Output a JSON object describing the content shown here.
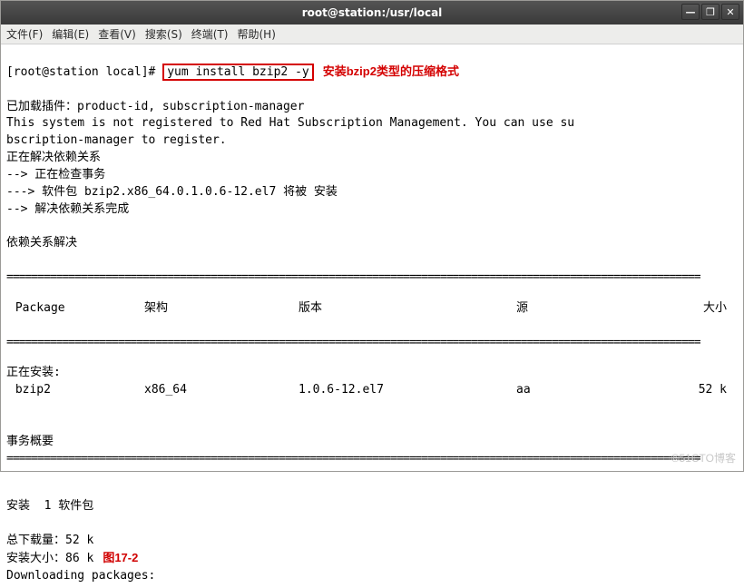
{
  "window": {
    "title": "root@station:/usr/local",
    "min": "—",
    "max": "❐",
    "close": "✕"
  },
  "menubar": {
    "file": "文件(F)",
    "edit": "编辑(E)",
    "view": "查看(V)",
    "search": "搜索(S)",
    "terminal": "终端(T)",
    "help": "帮助(H)"
  },
  "prompt": "[root@station local]# ",
  "command": "yum install bzip2 -y",
  "annotation1": "安装bzip2类型的压缩格式",
  "line2": "已加载插件：product-id, subscription-manager",
  "line3": "This system is not registered to Red Hat Subscription Management. You can use su",
  "line4": "bscription-manager to register.",
  "line5": "正在解决依赖关系",
  "line6": "--> 正在检查事务",
  "line7": "---> 软件包 bzip2.x86_64.0.1.0.6-12.el7 将被 安装",
  "line8": "--> 解决依赖关系完成",
  "line_blank": "",
  "line9": "依赖关系解决",
  "hr": "================================================================================================================",
  "hr_thin": "================================================================================================================",
  "table": {
    "head": {
      "pkg": " Package",
      "arch": "架构",
      "ver": "版本",
      "repo": "源",
      "size": "大小"
    },
    "section_install": "正在安装:",
    "row": {
      "pkg": " bzip2",
      "arch": "x86_64",
      "ver": "1.0.6-12.el7",
      "repo": "aa",
      "size": "52 k"
    }
  },
  "summary_title": "事务概要",
  "summary1": "安装  1 软件包",
  "summary2": "总下载量：52 k",
  "summary3": "安装大小：86 k",
  "fig_label": "图17-2",
  "downloading": "Downloading packages:",
  "watermark": "©51CTO博客"
}
